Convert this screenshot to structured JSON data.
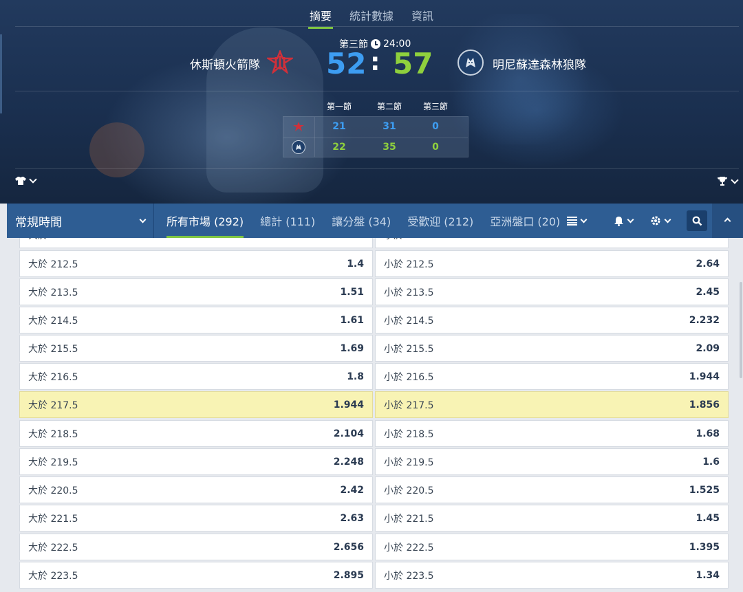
{
  "tabs": [
    {
      "label": "摘要",
      "active": true
    },
    {
      "label": "統計數據",
      "active": false
    },
    {
      "label": "資訊",
      "active": false
    }
  ],
  "match": {
    "period": "第三節",
    "clock": "24:00",
    "home": {
      "name": "休斯頓火箭隊",
      "score": "52",
      "logo": "rockets-logo-icon"
    },
    "away": {
      "name": "明尼蘇達森林狼隊",
      "score": "57",
      "logo": "timberwolves-logo-icon"
    },
    "colon": ":"
  },
  "quarters": {
    "headers": [
      "第一節",
      "第二節",
      "第三節"
    ],
    "home": [
      "21",
      "31",
      "0"
    ],
    "away": [
      "22",
      "35",
      "0"
    ]
  },
  "market_bar": {
    "period_select": "常規時間",
    "tabs": [
      {
        "label": "所有市場 (292)",
        "active": true
      },
      {
        "label": "總計 (111)",
        "active": false
      },
      {
        "label": "讓分盤 (34)",
        "active": false
      },
      {
        "label": "受歡迎 (212)",
        "active": false
      },
      {
        "label": "亞洲盤口 (20)",
        "active": false
      }
    ]
  },
  "odds_rows": [
    {
      "over_label": "大於",
      "under_label": "小於",
      "over_odds": "",
      "under_odds": "",
      "highlight": false
    },
    {
      "over_label": "大於 212.5",
      "over_odds": "1.4",
      "under_label": "小於 212.5",
      "under_odds": "2.64",
      "highlight": false
    },
    {
      "over_label": "大於 213.5",
      "over_odds": "1.51",
      "under_label": "小於 213.5",
      "under_odds": "2.45",
      "highlight": false
    },
    {
      "over_label": "大於 214.5",
      "over_odds": "1.61",
      "under_label": "小於 214.5",
      "under_odds": "2.232",
      "highlight": false
    },
    {
      "over_label": "大於 215.5",
      "over_odds": "1.69",
      "under_label": "小於 215.5",
      "under_odds": "2.09",
      "highlight": false
    },
    {
      "over_label": "大於 216.5",
      "over_odds": "1.8",
      "under_label": "小於 216.5",
      "under_odds": "1.944",
      "highlight": false
    },
    {
      "over_label": "大於 217.5",
      "over_odds": "1.944",
      "under_label": "小於 217.5",
      "under_odds": "1.856",
      "highlight": true
    },
    {
      "over_label": "大於 218.5",
      "over_odds": "2.104",
      "under_label": "小於 218.5",
      "under_odds": "1.68",
      "highlight": false
    },
    {
      "over_label": "大於 219.5",
      "over_odds": "2.248",
      "under_label": "小於 219.5",
      "under_odds": "1.6",
      "highlight": false
    },
    {
      "over_label": "大於 220.5",
      "over_odds": "2.42",
      "under_label": "小於 220.5",
      "under_odds": "1.525",
      "highlight": false
    },
    {
      "over_label": "大於 221.5",
      "over_odds": "2.63",
      "under_label": "小於 221.5",
      "under_odds": "1.45",
      "highlight": false
    },
    {
      "over_label": "大於 222.5",
      "over_odds": "2.656",
      "under_label": "小於 222.5",
      "under_odds": "1.395",
      "highlight": false
    },
    {
      "over_label": "大於 223.5",
      "over_odds": "2.895",
      "under_label": "小於 223.5",
      "under_odds": "1.34",
      "highlight": false
    }
  ],
  "colors": {
    "home_score": "#3d9df2",
    "away_score": "#8fd03d",
    "market_bar": "#2e5d93",
    "active_underline": "#7fc641",
    "highlight_row": "#f8f3b4"
  }
}
